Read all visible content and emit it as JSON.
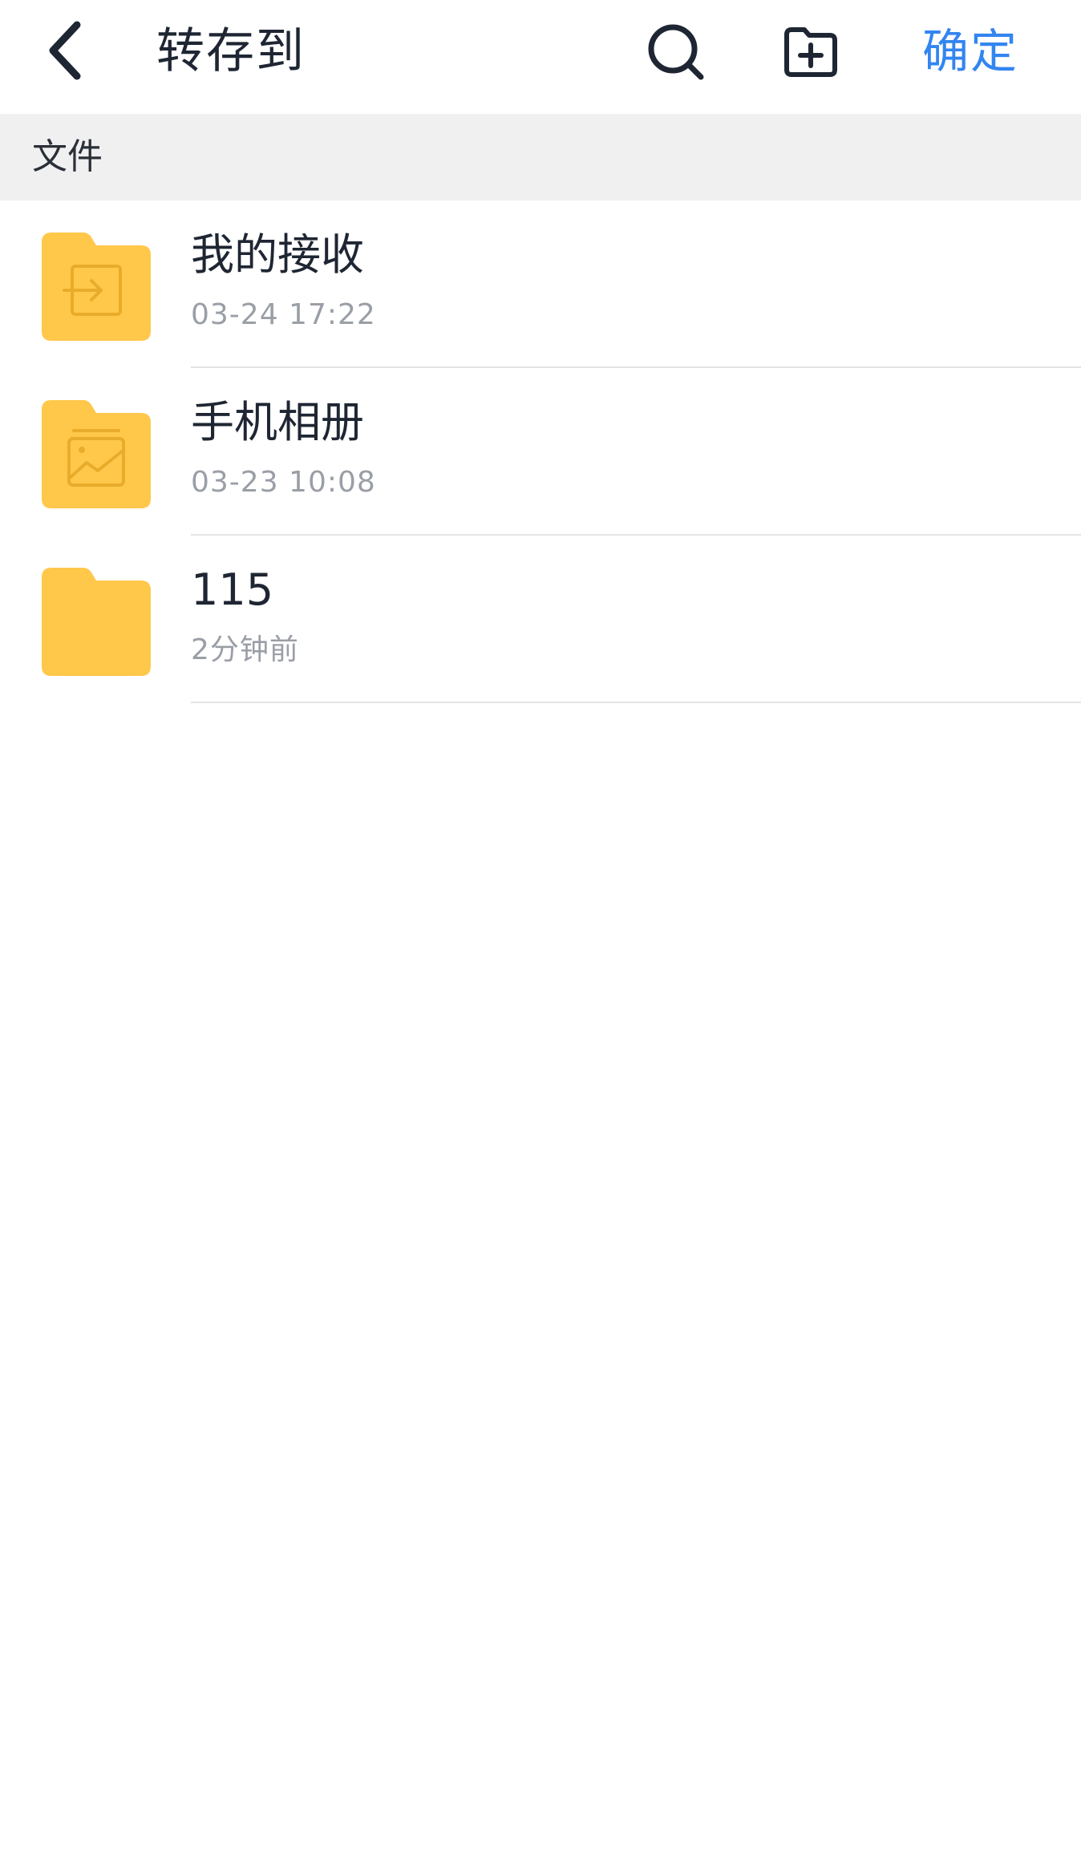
{
  "header": {
    "title": "转存到",
    "confirm_label": "确定",
    "back_icon": "chevron-left-icon",
    "search_icon": "search-icon",
    "new_folder_icon": "folder-plus-icon"
  },
  "section": {
    "label": "文件"
  },
  "files": [
    {
      "name": "我的接收",
      "meta": "03-24 17:22",
      "icon": "folder-receive-icon"
    },
    {
      "name": "手机相册",
      "meta": "03-23 10:08",
      "icon": "folder-album-icon"
    },
    {
      "name": "115",
      "meta": "2分钟前",
      "icon": "folder-icon"
    }
  ],
  "colors": {
    "accent": "#3385f0",
    "folder": "#ffc84a",
    "folder_glyph": "#e9ac2a",
    "section_bg": "#f0f0f0",
    "meta_text": "#9a9ea6"
  }
}
